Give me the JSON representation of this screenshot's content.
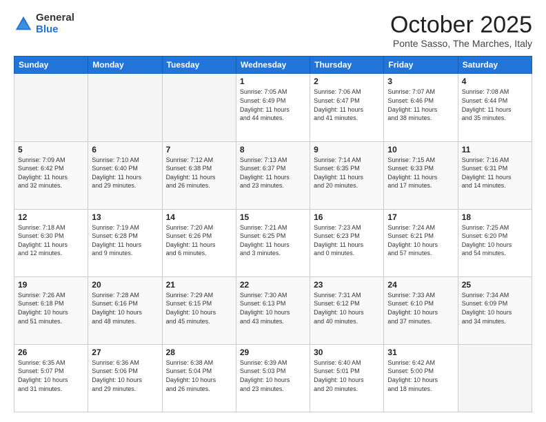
{
  "header": {
    "logo_general": "General",
    "logo_blue": "Blue",
    "month_title": "October 2025",
    "location": "Ponte Sasso, The Marches, Italy"
  },
  "weekdays": [
    "Sunday",
    "Monday",
    "Tuesday",
    "Wednesday",
    "Thursday",
    "Friday",
    "Saturday"
  ],
  "weeks": [
    [
      {
        "day": "",
        "info": ""
      },
      {
        "day": "",
        "info": ""
      },
      {
        "day": "",
        "info": ""
      },
      {
        "day": "1",
        "info": "Sunrise: 7:05 AM\nSunset: 6:49 PM\nDaylight: 11 hours\nand 44 minutes."
      },
      {
        "day": "2",
        "info": "Sunrise: 7:06 AM\nSunset: 6:47 PM\nDaylight: 11 hours\nand 41 minutes."
      },
      {
        "day": "3",
        "info": "Sunrise: 7:07 AM\nSunset: 6:46 PM\nDaylight: 11 hours\nand 38 minutes."
      },
      {
        "day": "4",
        "info": "Sunrise: 7:08 AM\nSunset: 6:44 PM\nDaylight: 11 hours\nand 35 minutes."
      }
    ],
    [
      {
        "day": "5",
        "info": "Sunrise: 7:09 AM\nSunset: 6:42 PM\nDaylight: 11 hours\nand 32 minutes."
      },
      {
        "day": "6",
        "info": "Sunrise: 7:10 AM\nSunset: 6:40 PM\nDaylight: 11 hours\nand 29 minutes."
      },
      {
        "day": "7",
        "info": "Sunrise: 7:12 AM\nSunset: 6:38 PM\nDaylight: 11 hours\nand 26 minutes."
      },
      {
        "day": "8",
        "info": "Sunrise: 7:13 AM\nSunset: 6:37 PM\nDaylight: 11 hours\nand 23 minutes."
      },
      {
        "day": "9",
        "info": "Sunrise: 7:14 AM\nSunset: 6:35 PM\nDaylight: 11 hours\nand 20 minutes."
      },
      {
        "day": "10",
        "info": "Sunrise: 7:15 AM\nSunset: 6:33 PM\nDaylight: 11 hours\nand 17 minutes."
      },
      {
        "day": "11",
        "info": "Sunrise: 7:16 AM\nSunset: 6:31 PM\nDaylight: 11 hours\nand 14 minutes."
      }
    ],
    [
      {
        "day": "12",
        "info": "Sunrise: 7:18 AM\nSunset: 6:30 PM\nDaylight: 11 hours\nand 12 minutes."
      },
      {
        "day": "13",
        "info": "Sunrise: 7:19 AM\nSunset: 6:28 PM\nDaylight: 11 hours\nand 9 minutes."
      },
      {
        "day": "14",
        "info": "Sunrise: 7:20 AM\nSunset: 6:26 PM\nDaylight: 11 hours\nand 6 minutes."
      },
      {
        "day": "15",
        "info": "Sunrise: 7:21 AM\nSunset: 6:25 PM\nDaylight: 11 hours\nand 3 minutes."
      },
      {
        "day": "16",
        "info": "Sunrise: 7:23 AM\nSunset: 6:23 PM\nDaylight: 11 hours\nand 0 minutes."
      },
      {
        "day": "17",
        "info": "Sunrise: 7:24 AM\nSunset: 6:21 PM\nDaylight: 10 hours\nand 57 minutes."
      },
      {
        "day": "18",
        "info": "Sunrise: 7:25 AM\nSunset: 6:20 PM\nDaylight: 10 hours\nand 54 minutes."
      }
    ],
    [
      {
        "day": "19",
        "info": "Sunrise: 7:26 AM\nSunset: 6:18 PM\nDaylight: 10 hours\nand 51 minutes."
      },
      {
        "day": "20",
        "info": "Sunrise: 7:28 AM\nSunset: 6:16 PM\nDaylight: 10 hours\nand 48 minutes."
      },
      {
        "day": "21",
        "info": "Sunrise: 7:29 AM\nSunset: 6:15 PM\nDaylight: 10 hours\nand 45 minutes."
      },
      {
        "day": "22",
        "info": "Sunrise: 7:30 AM\nSunset: 6:13 PM\nDaylight: 10 hours\nand 43 minutes."
      },
      {
        "day": "23",
        "info": "Sunrise: 7:31 AM\nSunset: 6:12 PM\nDaylight: 10 hours\nand 40 minutes."
      },
      {
        "day": "24",
        "info": "Sunrise: 7:33 AM\nSunset: 6:10 PM\nDaylight: 10 hours\nand 37 minutes."
      },
      {
        "day": "25",
        "info": "Sunrise: 7:34 AM\nSunset: 6:09 PM\nDaylight: 10 hours\nand 34 minutes."
      }
    ],
    [
      {
        "day": "26",
        "info": "Sunrise: 6:35 AM\nSunset: 5:07 PM\nDaylight: 10 hours\nand 31 minutes."
      },
      {
        "day": "27",
        "info": "Sunrise: 6:36 AM\nSunset: 5:06 PM\nDaylight: 10 hours\nand 29 minutes."
      },
      {
        "day": "28",
        "info": "Sunrise: 6:38 AM\nSunset: 5:04 PM\nDaylight: 10 hours\nand 26 minutes."
      },
      {
        "day": "29",
        "info": "Sunrise: 6:39 AM\nSunset: 5:03 PM\nDaylight: 10 hours\nand 23 minutes."
      },
      {
        "day": "30",
        "info": "Sunrise: 6:40 AM\nSunset: 5:01 PM\nDaylight: 10 hours\nand 20 minutes."
      },
      {
        "day": "31",
        "info": "Sunrise: 6:42 AM\nSunset: 5:00 PM\nDaylight: 10 hours\nand 18 minutes."
      },
      {
        "day": "",
        "info": ""
      }
    ]
  ]
}
